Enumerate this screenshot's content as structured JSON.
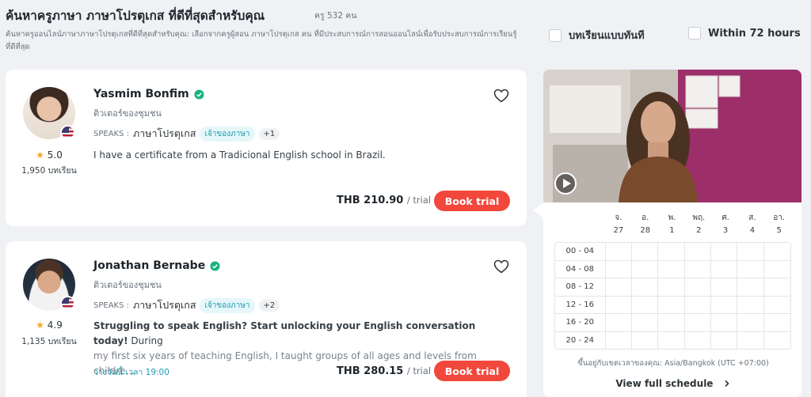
{
  "header": {
    "title": "ค้นหาครูภาษา ภาษาโปรตุเกส ที่ดีที่สุดสำหรับคุณ",
    "count": "ครู 532 คน",
    "subtitle": "ค้นหาครูออนไลน์ภาษาภาษาโปรตุเกสที่ดีที่สุดสำหรับคุณ: เลือกจากครูผู้สอน ภาษาโปรตุเกส คน ที่มีประสบการณ์การสอนออนไลน์เพื่อรับประสบการณ์การเรียนรู้ที่ดีที่สุด"
  },
  "filters": [
    {
      "label": "บทเรียนแบบทันที",
      "checked": false
    },
    {
      "label": "Within 72 hours",
      "checked": false
    }
  ],
  "tutors": [
    {
      "name": "Yasmim Bonfim",
      "tag": "ติวเตอร์ของชุมชน",
      "rating": "5.0",
      "lessons": "1,950 บทเรียน",
      "speaks_label": "SPEAKS :",
      "language": "ภาษาโปรตุเกส",
      "native_chip": "เจ้าของภาษา",
      "more_chip": "+1",
      "description_bold": "",
      "description": "I have a certificate from a Tradicional English school in Brazil.",
      "description_more": "",
      "price": "THB 210.90",
      "price_unit": "/ trial",
      "button": "Book trial",
      "availability": ""
    },
    {
      "name": "Jonathan Bernabe",
      "tag": "ติวเตอร์ของชุมชน",
      "rating": "4.9",
      "lessons": "1,135 บทเรียน",
      "speaks_label": "SPEAKS :",
      "language": "ภาษาโปรตุเกส",
      "native_chip": "เจ้าของภาษา",
      "more_chip": "+2",
      "description_bold": "Struggling to speak English? Start unlocking your English conversation today!",
      "description": " During",
      "description_more": "my first six years of teaching English, I taught groups of all ages and levels from childre...",
      "price": "THB 280.15",
      "price_unit": "/ trial",
      "button": "Book trial",
      "availability": "ว่างวันนี้ เวลา 19:00"
    }
  ],
  "schedule": {
    "days": [
      {
        "name": "จ.",
        "date": "27"
      },
      {
        "name": "อ.",
        "date": "28"
      },
      {
        "name": "พ.",
        "date": "1"
      },
      {
        "name": "พฤ.",
        "date": "2"
      },
      {
        "name": "ศ.",
        "date": "3"
      },
      {
        "name": "ส.",
        "date": "4"
      },
      {
        "name": "อา.",
        "date": "5"
      }
    ],
    "slots": [
      "00 - 04",
      "04 - 08",
      "08 - 12",
      "12 - 16",
      "16 - 20",
      "20 - 24"
    ],
    "timezone": "ขึ้นอยู่กับเขตเวลาของคุณ: Asia/Bangkok (UTC +07:00)",
    "view_full": "View full schedule"
  },
  "colors": {
    "accent": "#f2473b",
    "teal": "#1d9ab1",
    "star": "#f5a623",
    "verified": "#19b37c"
  },
  "icons": [
    "checkbox-icon",
    "verified-icon",
    "heart-icon",
    "star-icon",
    "us-flag-icon",
    "play-icon",
    "chevron-right-icon"
  ]
}
